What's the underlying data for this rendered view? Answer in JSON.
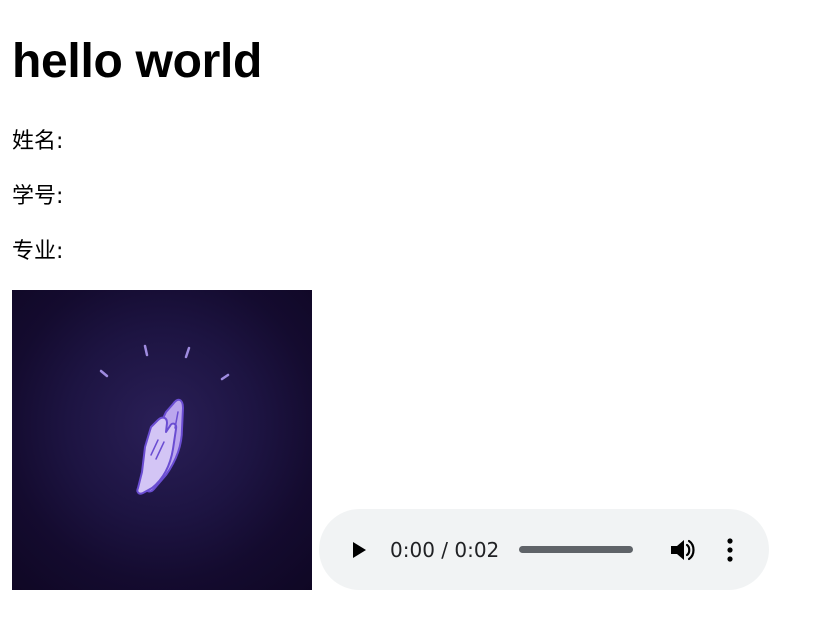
{
  "heading": "hello world",
  "fields": {
    "name_label": "姓名:",
    "student_id_label": "学号:",
    "major_label": "专业:"
  },
  "image": {
    "icon": "clapping-hands-icon",
    "colors": {
      "background": "#1b113d",
      "hands": "#c5b3f0",
      "outline": "#6b4fd0"
    }
  },
  "audio_player": {
    "time_display": "0:00 / 0:02",
    "play_icon": "play-icon",
    "volume_icon": "volume-icon",
    "menu_icon": "more-vert-icon",
    "background": "#f1f3f4"
  }
}
